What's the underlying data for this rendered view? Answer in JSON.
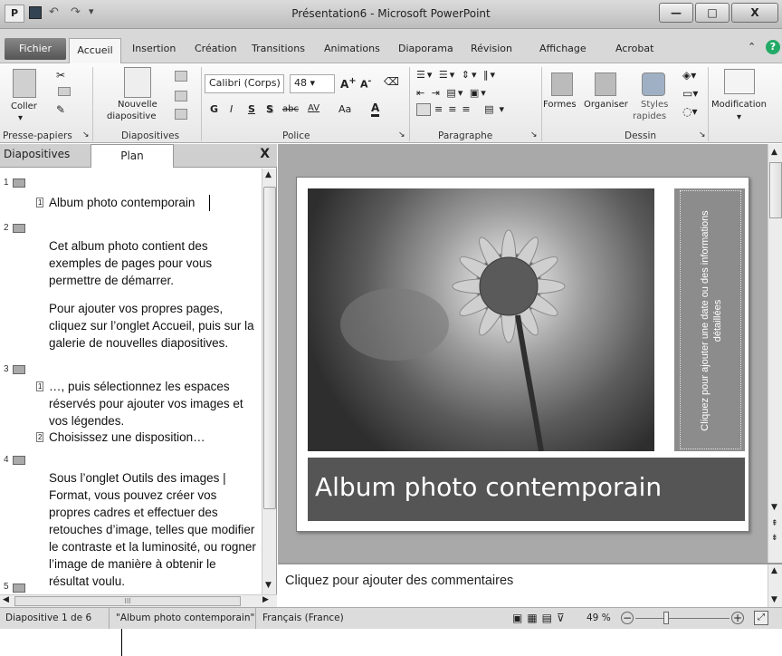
{
  "window": {
    "title": "Présentation6 - Microsoft PowerPoint",
    "app_icon": "P",
    "minimize": "—",
    "maximize": "□",
    "close": "X"
  },
  "tabs": [
    "Fichier",
    "Accueil",
    "Insertion",
    "Création",
    "Transitions",
    "Animations",
    "Diaporama",
    "Révision",
    "Affichage",
    "Acrobat"
  ],
  "ribbon": {
    "coller": "Coller",
    "nouvelle_l1": "Nouvelle",
    "nouvelle_l2": "diapositive",
    "font_name": "Calibri (Corps)",
    "font_size": "48",
    "formes": "Formes",
    "organiser": "Organiser",
    "styles_l1": "Styles",
    "styles_l2": "rapides",
    "modification": "Modification",
    "groups": {
      "presse_papiers": "Presse-papiers",
      "diapositives": "Diapositives",
      "police": "Police",
      "paragraphe": "Paragraphe",
      "dessin": "Dessin"
    },
    "font_buttons": [
      "G",
      "I",
      "S",
      "S",
      "abc",
      "AV",
      "Aa",
      "A"
    ]
  },
  "panel": {
    "tab_diapositives": "Diapositives",
    "tab_plan": "Plan",
    "close": "X"
  },
  "outline": {
    "s1_num": "1",
    "s1_title": "Album photo contemporain",
    "s2_num": "2",
    "s2_p1": "Cet album photo contient des exemples de pages pour vous permettre de démarrer.",
    "s2_p2": "Pour ajouter vos propres pages, cliquez sur l’onglet Accueil, puis sur la galerie de nouvelles diapositives.",
    "s3_num": "3",
    "s3_b1": "…, puis sélectionnez les espaces réservés pour ajouter vos images et vos légendes.",
    "s3_b2": "Choisissez une disposition…",
    "s4_num": "4",
    "s4_p1": "Sous l’onglet Outils des images | Format, vous pouvez créer vos propres cadres et effectuer des retouches d’image, telles que modifier le contraste et la luminosité, ou rogner l’image de manière à obtenir le résultat voulu.",
    "s5_num": "5",
    "hscroll_grip": "III"
  },
  "slide": {
    "side_text": "Cliquez pour ajouter une date ou des informations détaillées",
    "title": "Album photo contemporain"
  },
  "notes": {
    "placeholder": "Cliquez pour ajouter des commentaires"
  },
  "status": {
    "slide_info": "Diapositive 1 de 6",
    "theme": "\"Album photo contemporain\"",
    "language": "Français (France)",
    "zoom": "49 %"
  }
}
